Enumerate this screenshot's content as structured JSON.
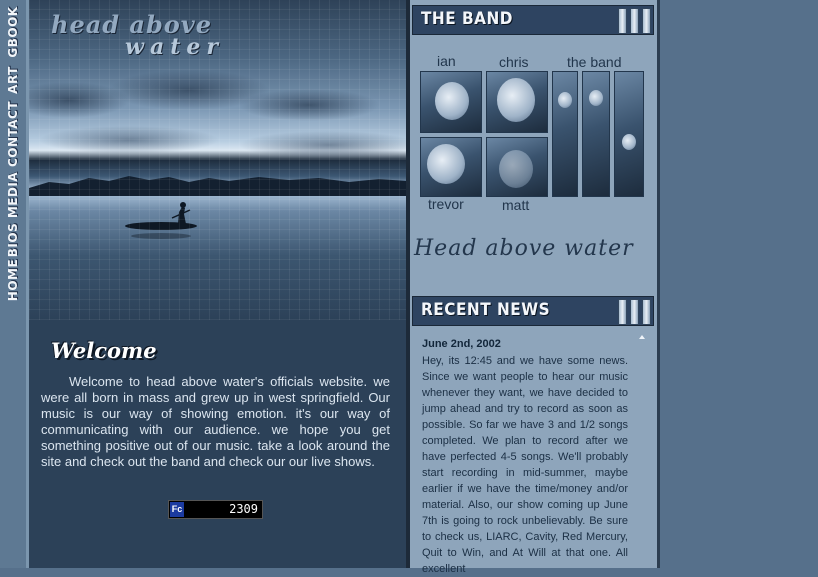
{
  "nav": {
    "items": [
      {
        "label": "GBOOK"
      },
      {
        "label": "ART"
      },
      {
        "label": "CONTACT"
      },
      {
        "label": "MEDIA"
      },
      {
        "label": "BIOS"
      },
      {
        "label": "HOME"
      }
    ]
  },
  "logo": {
    "line1": "head above",
    "line2": "water"
  },
  "welcome": {
    "title": "Welcome",
    "text": "Welcome to head above water's officials website. we were all born in mass and grew up in west springfield. Our music is our way of showing emotion. it's our way of communicating with our audience. we hope you get something positive out of our music. take a look around the site and check out the band and check our our live shows."
  },
  "counter": {
    "badge": "Fc",
    "value": "2309"
  },
  "band": {
    "header": "THE BAND",
    "members": {
      "ian": "ian",
      "chris": "chris",
      "the_band": "the band",
      "trevor": "trevor",
      "matt": "matt"
    },
    "handwritten_logo": "Head above water"
  },
  "news": {
    "header": "RECENT NEWS",
    "date": "June 2nd, 2002",
    "body": "Hey, its 12:45 and we have some news. Since we want people to hear our music whenever they want, we have decided to jump ahead and try to record as soon as possible. So far we have 3 and 1/2 songs completed. We plan to record after we have perfected 4-5 songs. We'll probably start recording in mid-summer, maybe earlier if we have the time/money and/or material. Also, our show coming up June 7th is going to rock unbelievably. Be sure to check us, LIARC, Cavity, Red Mercury, Quit to Win, and At Will at that one. All excellent"
  },
  "colors": {
    "background": "#56708b",
    "main_panel": "#2c4158",
    "right_panel": "#8ea5bb",
    "header_bar": "#2e4461"
  }
}
